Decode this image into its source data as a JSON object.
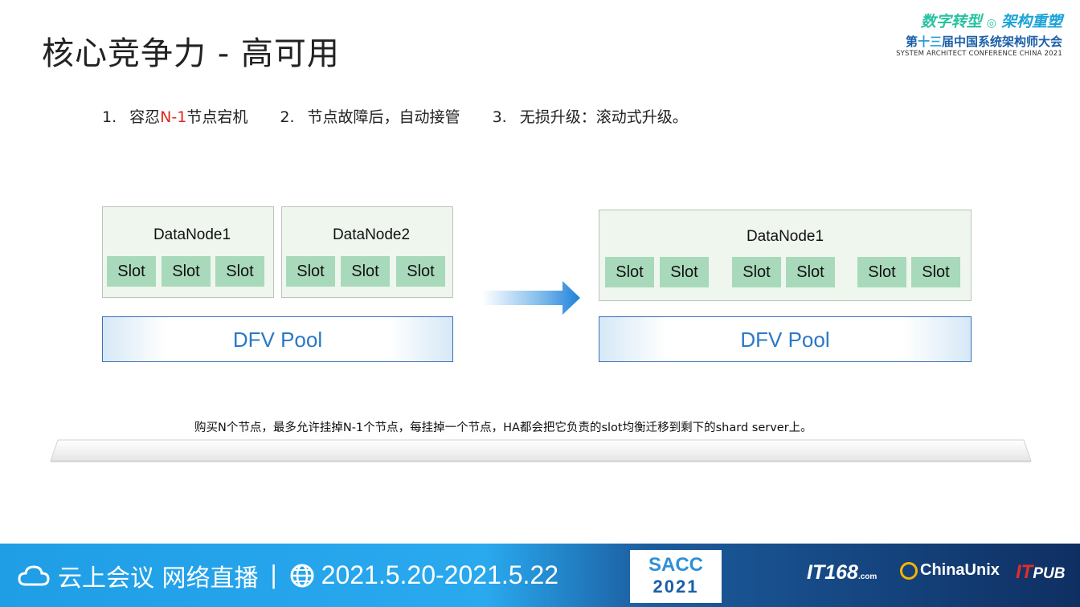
{
  "slide": {
    "title": "核心竞争力 - 高可用",
    "brand": {
      "slogan_part1": "数字转型",
      "slogan_part2": "架构重塑",
      "conference_prefix": "第",
      "conference_number": "十三",
      "conference_suffix": "届中国系统架构师大会",
      "conference_en": "SYSTEM ARCHITECT CONFERENCE CHINA 2021"
    },
    "points": [
      {
        "index": "1.",
        "text_before": "容忍",
        "highlight": "N-1",
        "text_after": "节点宕机"
      },
      {
        "index": "2.",
        "text": "节点故障后，自动接管"
      },
      {
        "index": "3.",
        "text": "无损升级：滚动式升级。"
      }
    ],
    "left_diagram": {
      "nodes": [
        {
          "label": "DataNode1",
          "slots": [
            "Slot",
            "Slot",
            "Slot"
          ]
        },
        {
          "label": "DataNode2",
          "slots": [
            "Slot",
            "Slot",
            "Slot"
          ]
        }
      ],
      "pool": "DFV Pool"
    },
    "right_diagram": {
      "node": {
        "label": "DataNode1",
        "slots": [
          "Slot",
          "Slot",
          "Slot",
          "Slot",
          "Slot",
          "Slot"
        ]
      },
      "pool": "DFV Pool"
    },
    "note": "购买N个节点，最多允许挂掉N-1个节点，每挂掉一个节点，HA都会把它负责的slot均衡迁移到剩下的shard server上。"
  },
  "footer": {
    "live_text": "云上会议 网络直播",
    "separator": "|",
    "date": "2021.5.20-2021.5.22",
    "sacc_line1": "SACC",
    "sacc_line2": "2021",
    "logos": [
      "IT168",
      ".com",
      "ChinaUnix",
      "IT",
      "PUB"
    ]
  },
  "icons": [
    "cloud-icon",
    "globe-icon",
    "arrow-right-icon"
  ],
  "colors": {
    "highlight": "#e0261b",
    "slot_fill": "#a9d9bb",
    "pool_text": "#2b78c6",
    "footer_blue": "#1f9ee6"
  }
}
